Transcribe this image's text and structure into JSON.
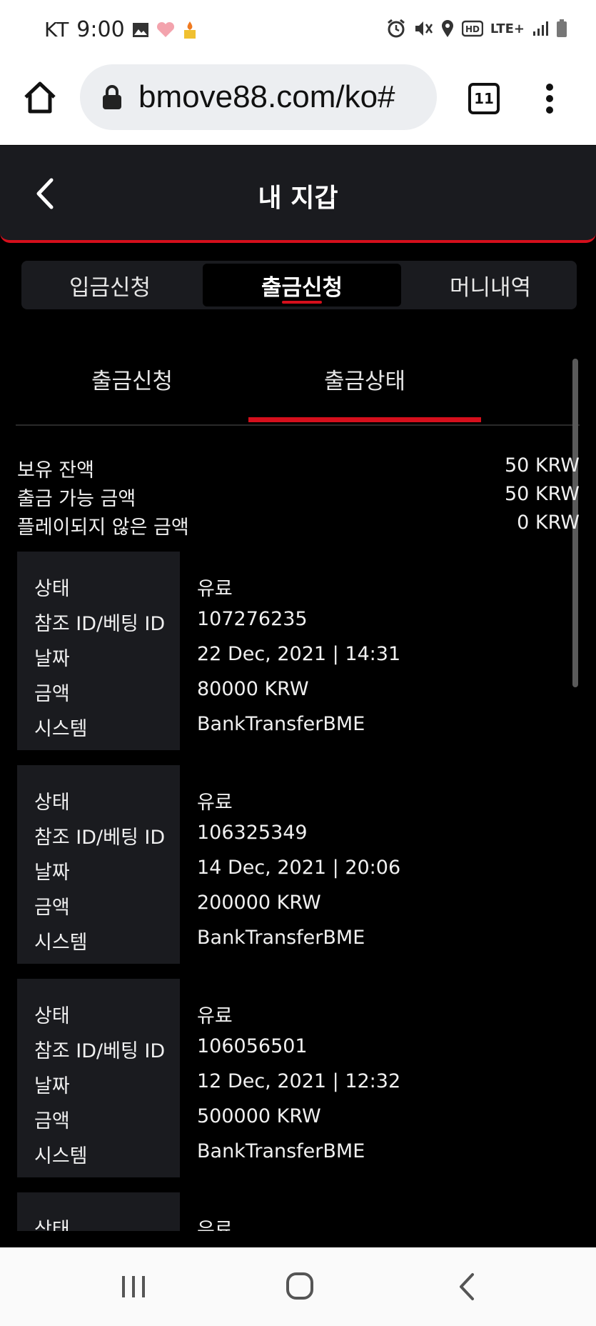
{
  "status_bar": {
    "carrier": "KT",
    "time": "9:00",
    "left_icons": [
      "image-icon",
      "heart-icon",
      "flame-icon"
    ],
    "right_icons": [
      "alarm-icon",
      "mute-icon",
      "location-icon",
      "hd-icon",
      "lte-icon",
      "signal-icon",
      "battery-icon"
    ],
    "lte_label": "LTE+"
  },
  "browser": {
    "url": "bmove88.com/ko#",
    "tab_count": "11"
  },
  "wallet": {
    "title": "내 지갑"
  },
  "main_tabs": [
    {
      "label": "입금신청",
      "active": false
    },
    {
      "label": "출금신청",
      "active": true
    },
    {
      "label": "머니내역",
      "active": false
    }
  ],
  "sub_tabs": [
    {
      "label": "출금신청",
      "active": false
    },
    {
      "label": "출금상태",
      "active": true
    }
  ],
  "balances": [
    {
      "label": "보유 잔액",
      "value": "50 KRW"
    },
    {
      "label": "출금 가능 금액",
      "value": "50 KRW"
    },
    {
      "label": "플레이되지 않은 금액",
      "value": "0 KRW"
    }
  ],
  "record_labels": {
    "status": "상태",
    "ref_id": "참조 ID/베팅 ID",
    "date": "날짜",
    "amount": "금액",
    "system": "시스템"
  },
  "records": [
    {
      "status": "유료",
      "ref_id": "107276235",
      "date": "22 Dec, 2021 | 14:31",
      "amount": "80000 KRW",
      "system": "BankTransferBME"
    },
    {
      "status": "유료",
      "ref_id": "106325349",
      "date": "14 Dec, 2021 | 20:06",
      "amount": "200000 KRW",
      "system": "BankTransferBME"
    },
    {
      "status": "유료",
      "ref_id": "106056501",
      "date": "12 Dec, 2021 | 12:32",
      "amount": "500000 KRW",
      "system": "BankTransferBME"
    },
    {
      "status": "유료"
    }
  ],
  "colors": {
    "accent": "#d50f1c",
    "panel": "#1a1b1f",
    "background": "#000000"
  }
}
